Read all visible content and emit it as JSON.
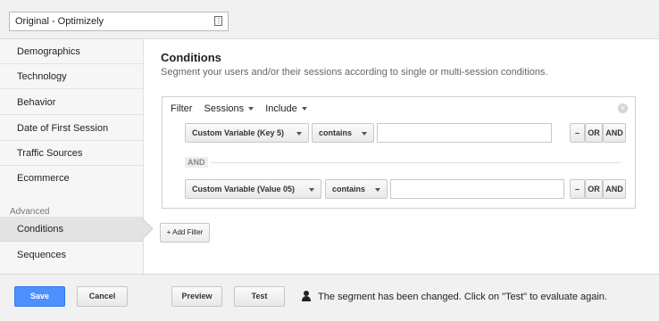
{
  "header": {
    "segment_name": "Original - Optimizely",
    "segment_icon": "document-icon"
  },
  "sidebar": {
    "items": [
      {
        "label": "Demographics"
      },
      {
        "label": "Technology"
      },
      {
        "label": "Behavior"
      },
      {
        "label": "Date of First Session"
      },
      {
        "label": "Traffic Sources"
      },
      {
        "label": "Ecommerce"
      }
    ],
    "advanced_label": "Advanced",
    "advanced_items": [
      {
        "label": "Conditions",
        "active": true
      },
      {
        "label": "Sequences"
      }
    ]
  },
  "main": {
    "title": "Conditions",
    "subtitle": "Segment your users and/or their sessions according to single or multi-session conditions.",
    "filter": {
      "label": "Filter",
      "scope": "Sessions",
      "mode": "Include",
      "rows": [
        {
          "dimension": "Custom Variable (Key 5)",
          "operator": "contains",
          "value": ""
        },
        {
          "dimension": "Custom Variable (Value 05)",
          "operator": "contains",
          "value": ""
        }
      ],
      "and_separator": "AND",
      "minus_label": "–",
      "or_label": "OR",
      "and_label": "AND"
    },
    "add_filter_label": "+ Add Filter"
  },
  "footer": {
    "save_label": "Save",
    "cancel_label": "Cancel",
    "preview_label": "Preview",
    "test_label": "Test",
    "status_text": "The segment has been changed. Click on \"Test\" to evaluate again."
  },
  "colors": {
    "primary_button": "#4d90fe",
    "sidebar_bg": "#f6f6f6",
    "active_item_bg": "#e3e3e3"
  }
}
